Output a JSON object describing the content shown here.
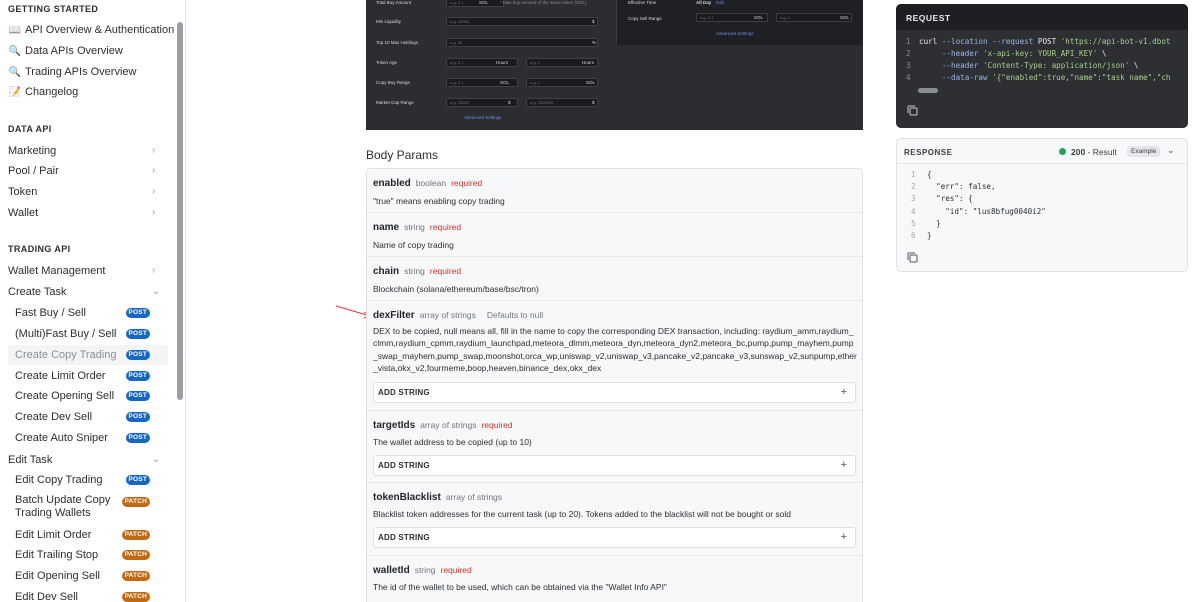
{
  "sidebar": {
    "sections": [
      {
        "heading": "GETTING STARTED"
      },
      {
        "heading": "DATA API"
      },
      {
        "heading": "TRADING API"
      }
    ],
    "getting_started": [
      {
        "emoji": "📖",
        "label": "API Overview & Authentication"
      },
      {
        "emoji": "🔍",
        "label": "Data APIs Overview"
      },
      {
        "emoji": "🔍",
        "label": "Trading APIs Overview"
      },
      {
        "emoji": "📝",
        "label": "Changelog"
      }
    ],
    "data_api": [
      {
        "label": "Marketing"
      },
      {
        "label": "Pool / Pair"
      },
      {
        "label": "Token"
      },
      {
        "label": "Wallet"
      }
    ],
    "trading_api": {
      "wallet_management": "Wallet Management",
      "create_task": "Create Task",
      "create_task_items": [
        {
          "label": "Fast Buy / Sell",
          "method": "POST"
        },
        {
          "label": "(Multi)Fast Buy / Sell",
          "method": "POST"
        },
        {
          "label": "Create Copy Trading",
          "method": "POST"
        },
        {
          "label": "Create Limit Order",
          "method": "POST"
        },
        {
          "label": "Create Opening Sell",
          "method": "POST"
        },
        {
          "label": "Create Dev Sell",
          "method": "POST"
        },
        {
          "label": "Create Auto Sniper",
          "method": "POST"
        }
      ],
      "edit_task": "Edit Task",
      "edit_task_items": [
        {
          "label": "Edit Copy Trading",
          "method": "POST"
        },
        {
          "label": "Batch Update Copy Trading Wallets",
          "method": "PATCH"
        },
        {
          "label": "Edit Limit Order",
          "method": "PATCH"
        },
        {
          "label": "Edit Trailing Stop",
          "method": "PATCH"
        },
        {
          "label": "Edit Opening Sell",
          "method": "PATCH"
        },
        {
          "label": "Edit Dev Sell",
          "method": "PATCH"
        }
      ]
    }
  },
  "ui_image": {
    "left_rows": [
      {
        "label": "Total Buy Amount",
        "placeholder": "e.g. 0.1",
        "unit": "SOL",
        "note": "* Max buy amount of the same token (SOL)"
      },
      {
        "label": "Min Liquidity",
        "placeholder": "e.g. 10000",
        "unit": "$"
      },
      {
        "label": "Top 10 Max Holdings",
        "placeholder": "e.g. 30",
        "unit": "%"
      },
      {
        "label": "Token Age",
        "placeholder": "e.g. 0.1",
        "unit": "Hours",
        "placeholder2": "e.g. 1",
        "unit2": "Hours"
      },
      {
        "label": "Copy Buy Range",
        "placeholder": "e.g. 0.1",
        "unit": "SOL",
        "placeholder2": "e.g. 1",
        "unit2": "SOL"
      },
      {
        "label": "Market Cap Range",
        "placeholder": "e.g. 10000",
        "unit": "$",
        "placeholder2": "e.g. 1000000",
        "unit2": "$"
      }
    ],
    "advanced_settings": "Advanced Settings",
    "right_rows": [
      {
        "label": "Effective Time",
        "value": "All Day",
        "edit": "Edit"
      },
      {
        "label": "Copy Sell Range",
        "placeholder": "e.g. 0.1",
        "unit": "SOL",
        "placeholder2": "e.g. 1",
        "unit2": "SOL"
      }
    ],
    "right_advanced_settings": "Advanced Settings"
  },
  "body_params": {
    "title": "Body Params",
    "add_label": "ADD STRING",
    "params": [
      {
        "name": "enabled",
        "type": "boolean",
        "required": "required",
        "desc": "\"true\" means enabling copy trading"
      },
      {
        "name": "name",
        "type": "string",
        "required": "required",
        "desc": "Name of copy trading"
      },
      {
        "name": "chain",
        "type": "string",
        "required": "required",
        "desc": "Blockchain (solana/ethereum/base/bsc/tron)"
      },
      {
        "name": "dexFilter",
        "type": "array of strings",
        "default": "Defaults to null",
        "desc": "DEX to be copied, null means all, fill in the name to copy the corresponding DEX transaction, including: raydium_amm,raydium_clmm,raydium_cpmm,raydium_launchpad,meteora_dlmm,meteora_dyn,meteora_dyn2,meteora_bc,pump,pump_mayhem,pump_swap_mayhem,pump_swap,moonshot,orca_wp,uniswap_v2,uniswap_v3,pancake_v2,pancake_v3,sunswap_v2,sunpump,ether_vista,okx_v2,fourmeme,boop,heaven,binance_dex,okx_dex"
      },
      {
        "name": "targetIds",
        "type": "array of strings",
        "required": "required",
        "desc": "The wallet address to be copied (up to 10)"
      },
      {
        "name": "tokenBlacklist",
        "type": "array of strings",
        "desc": "Blacklist token addresses for the current task (up to 20). Tokens added to the blacklist will not be bought or sold"
      },
      {
        "name": "walletId",
        "type": "string",
        "required": "required",
        "desc": "The id of the wallet to be used, which can be obtained via the \"Wallet Info API\""
      }
    ]
  },
  "request": {
    "title": "REQUEST",
    "lines": [
      {
        "n": "1",
        "parts": [
          {
            "t": "kw",
            "v": "curl "
          },
          {
            "t": "flag",
            "v": "--location --request "
          },
          {
            "t": "kw",
            "v": "POST "
          },
          {
            "t": "str",
            "v": "'https://api-bot-v1.dbot"
          }
        ]
      },
      {
        "n": "2",
        "parts": [
          {
            "t": "flag",
            "v": "     --header "
          },
          {
            "t": "str",
            "v": "'x-api-key: YOUR_API_KEY'"
          },
          {
            "t": "kw",
            "v": " \\"
          }
        ]
      },
      {
        "n": "3",
        "parts": [
          {
            "t": "flag",
            "v": "     --header "
          },
          {
            "t": "str",
            "v": "'Content-Type: application/json'"
          },
          {
            "t": "kw",
            "v": " \\"
          }
        ]
      },
      {
        "n": "4",
        "parts": [
          {
            "t": "flag",
            "v": "     --data-raw "
          },
          {
            "t": "str",
            "v": "'{\"enabled\":true,\"name\":\"task name\",\"ch"
          }
        ]
      }
    ]
  },
  "response": {
    "title": "RESPONSE",
    "status_code": "200",
    "status_text": "- Result",
    "example_label": "Example",
    "lines": [
      {
        "n": "1",
        "text": "{"
      },
      {
        "n": "2",
        "text": "  \"err\": false,"
      },
      {
        "n": "3",
        "text": "  \"res\": {"
      },
      {
        "n": "4",
        "text": "    \"id\": \"lus8bfug0040i2\""
      },
      {
        "n": "5",
        "text": "  }"
      },
      {
        "n": "6",
        "text": "}"
      }
    ]
  },
  "colors": {
    "post_badge": "#1666c5",
    "patch_badge": "#c26a12",
    "required": "#c8372d",
    "status_ok": "#22a05c"
  }
}
